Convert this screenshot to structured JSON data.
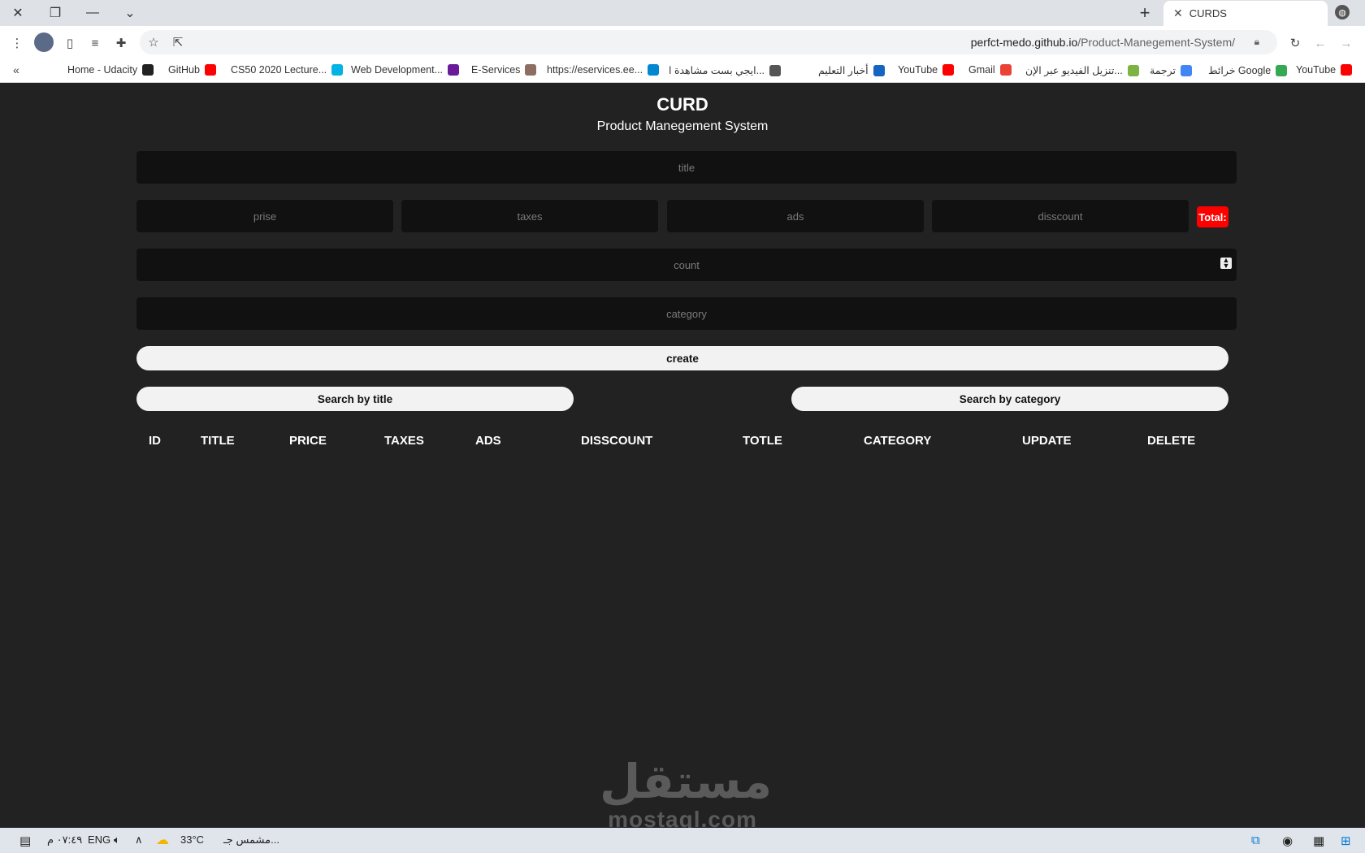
{
  "browser": {
    "tab_title": "CURDS",
    "url_host": "perfct-medo.github.io",
    "url_path": "/Product-Manegement-System/",
    "bookmarks": [
      {
        "label": "YouTube",
        "color": "#ff0000",
        "icon": "youtube-icon"
      },
      {
        "label": "خرائط Google",
        "color": "#34a853",
        "icon": "maps-icon"
      },
      {
        "label": "ترجمة",
        "color": "#4285f4",
        "icon": "translate-icon"
      },
      {
        "label": "تنزيل الفيديو عبر الإن...",
        "color": "#7cb342",
        "icon": "download-icon"
      },
      {
        "label": "Gmail",
        "color": "#ea4335",
        "icon": "gmail-icon"
      },
      {
        "label": "YouTube",
        "color": "#ff0000",
        "icon": "youtube-icon"
      },
      {
        "label": "أخبار التعليم",
        "color": "#1565c0",
        "icon": "news-icon"
      },
      {
        "label": "ايجي بست مشاهدة ا...",
        "color": "#555555",
        "icon": "globe-icon"
      },
      {
        "label": "https://eservices.ee...",
        "color": "#0288d1",
        "icon": "site-icon"
      },
      {
        "label": "E-Services",
        "color": "#8d6e63",
        "icon": "site-icon"
      },
      {
        "label": "Web Development...",
        "color": "#6a1b9a",
        "icon": "eservices-icon"
      },
      {
        "label": "CS50 2020 Lecture...",
        "color": "#02b3e4",
        "icon": "udacity-icon"
      },
      {
        "label": "GitHub",
        "color": "#ff0000",
        "icon": "youtube-icon"
      },
      {
        "label": "Home - Udacity",
        "color": "#222222",
        "icon": "github-icon"
      }
    ]
  },
  "app": {
    "title": "CURD",
    "subtitle": "Product Manegement System",
    "placeholders": {
      "title": "title",
      "price": "prise",
      "taxes": "taxes",
      "ads": "ads",
      "discount": "disscount",
      "count": "count",
      "category": "category"
    },
    "total_label": "Total:",
    "create_label": "create",
    "search_title_label": "Search by title",
    "search_category_label": "Search by category",
    "table_headers": [
      "ID",
      "TITLE",
      "PRICE",
      "TAXES",
      "ADS",
      "DISSCOUNT",
      "TOTLE",
      "CATEGORY",
      "UPDATE",
      "DELETE"
    ],
    "accent_color": "#ff0000"
  },
  "watermark": {
    "arabic": "مستقل",
    "latin": "mostaql.com"
  },
  "taskbar": {
    "time": "٠٧:٤٩ م",
    "lang": "ENG",
    "weather_temp": "33°C",
    "weather_text": "مشمس جـ..."
  }
}
